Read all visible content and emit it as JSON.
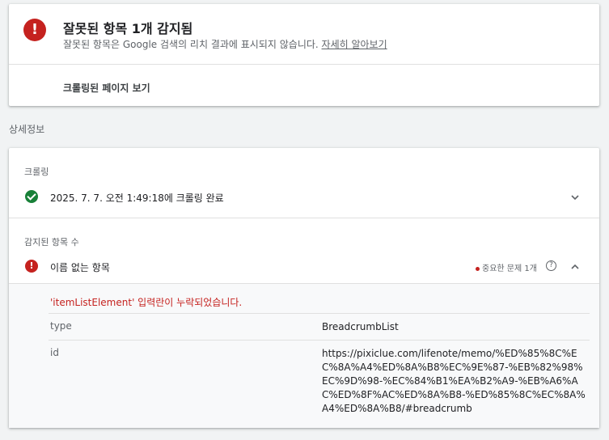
{
  "summary": {
    "title": "잘못된 항목 1개 감지됨",
    "description": "잘못된 항목은 Google 검색의 리치 결과에 표시되지 않습니다.",
    "learn_more": "자세히 알아보기",
    "view_crawled": "크롤링된 페이지 보기"
  },
  "section_title": "상세정보",
  "crawl": {
    "label": "크롤링",
    "status": "2025. 7. 7. 오전 1:49:18에 크롤링 완료"
  },
  "items": {
    "label": "감지된 항목 수",
    "item_name": "이름 없는 항목",
    "issue_tag": "중요한 문제 1개",
    "error_message": "'itemListElement' 입력란이 누락되었습니다.",
    "properties": [
      {
        "key": "type",
        "value": "BreadcrumbList"
      },
      {
        "key": "id",
        "value": "https://pixiclue.com/lifenote/memo/%ED%85%8C%EC%8A%A4%ED%8A%B8%EC%9E%87-%EB%82%98%EC%9D%98-%EC%84%B1%EA%B2%A9-%EB%A6%AC%ED%8F%AC%ED%8A%B8-%ED%85%8C%EC%8A%A4%ED%8A%B8/#breadcrumb"
      }
    ]
  },
  "colors": {
    "error": "#c5221f",
    "success": "#188038"
  }
}
